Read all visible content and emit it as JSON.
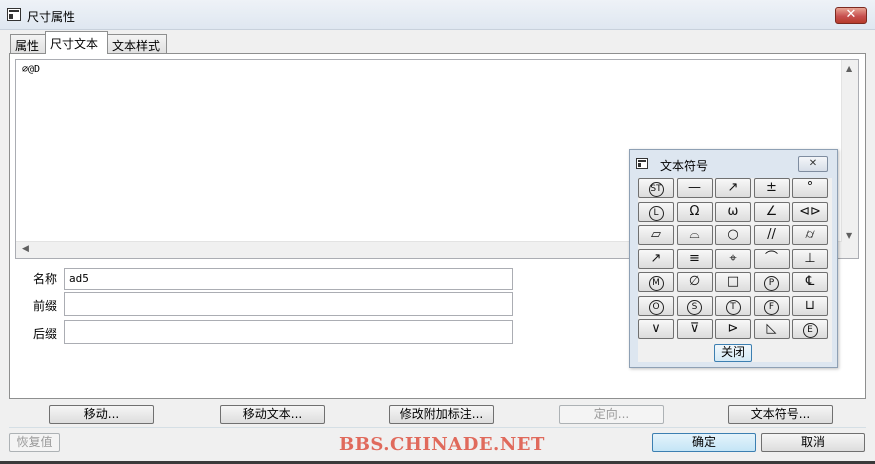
{
  "window": {
    "title": "尺寸属性",
    "close_glyph": "✕"
  },
  "tabs": [
    {
      "label": "属性"
    },
    {
      "label": "尺寸文本"
    },
    {
      "label": "文本样式"
    }
  ],
  "text_editor": {
    "content": "∅@D"
  },
  "fields": {
    "name": {
      "label": "名称",
      "value": "ad5"
    },
    "prefix": {
      "label": "前缀",
      "value": ""
    },
    "suffix": {
      "label": "后缀",
      "value": ""
    }
  },
  "buttons": {
    "move": "移动...",
    "move_text": "移动文本...",
    "modify_annotation": "修改附加标注...",
    "orient": "定向...",
    "text_symbol": "文本符号...",
    "restore": "恢复值",
    "ok": "确定",
    "cancel": "取消"
  },
  "watermark": "BBS.CHINADE.NET",
  "symbol_palette": {
    "title": "文本符号",
    "close_button": "关闭",
    "symbols": [
      "ST",
      "—",
      "↗",
      "±",
      "°",
      "L",
      "Ω",
      "ω",
      "∠",
      "⊲⊳",
      "▱",
      "⌓",
      "○",
      "//",
      "⌭",
      "↗",
      "≡",
      "⌖",
      "⌒",
      "⊥",
      "M",
      "∅",
      "□",
      "P",
      "℄",
      "O",
      "S",
      "T",
      "F",
      "⊔",
      "∨",
      "⊽",
      "⊳",
      "◺",
      "E"
    ]
  }
}
